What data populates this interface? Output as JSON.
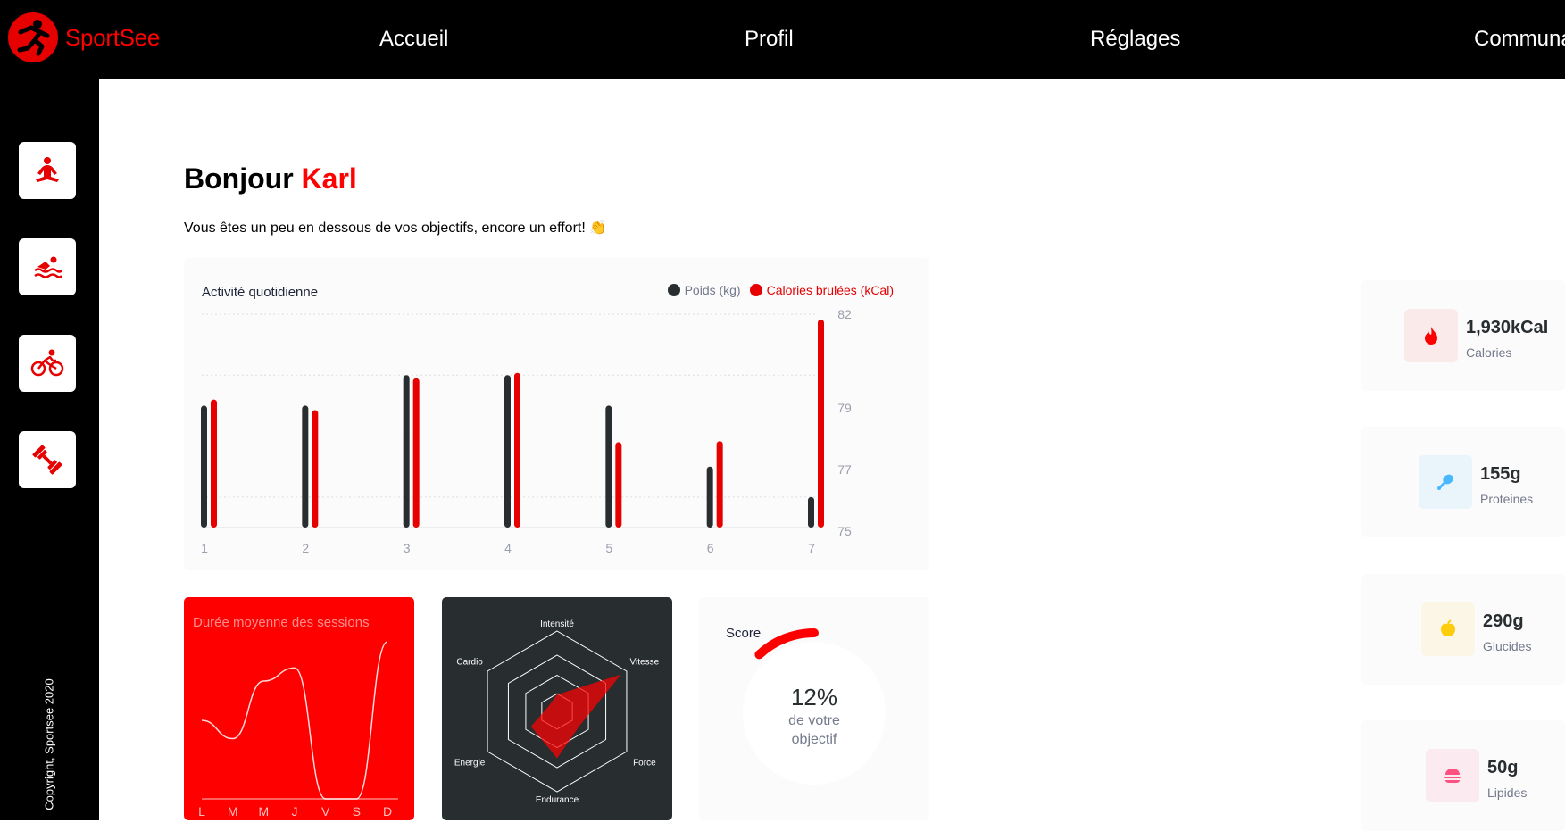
{
  "brand": {
    "name": "SportSee"
  },
  "nav": [
    {
      "label": "Accueil"
    },
    {
      "label": "Profil"
    },
    {
      "label": "Réglages"
    },
    {
      "label": "Communauté"
    }
  ],
  "sidebar": {
    "items": [
      {
        "icon": "meditation-icon"
      },
      {
        "icon": "swimming-icon"
      },
      {
        "icon": "cycling-icon"
      },
      {
        "icon": "dumbbell-icon"
      }
    ],
    "copyright": "Copyright, Sportsee 2020"
  },
  "greeting": {
    "prefix": "Bonjour ",
    "name": "Karl"
  },
  "subtitle": "Vous êtes un peu en dessous de vos objectifs, encore un effort! 👏",
  "colors": {
    "accent": "#ff0101",
    "dark": "#282d30"
  },
  "activity_chart": {
    "title": "Activité quotidienne",
    "legend": {
      "weight": "Poids (kg)",
      "calories": "Calories brulées (kCal)"
    },
    "chart_data": {
      "type": "bar",
      "categories": [
        "1",
        "2",
        "3",
        "4",
        "5",
        "6",
        "7"
      ],
      "series": [
        {
          "name": "Poids (kg)",
          "values": [
            79,
            79,
            80,
            80,
            79,
            77,
            76
          ]
        },
        {
          "name": "Calories brulées (kCal)",
          "values": [
            240,
            220,
            280,
            290,
            160,
            162,
            390
          ]
        }
      ],
      "y_ticks": [
        "82",
        "79",
        "77",
        "75"
      ],
      "ylim": [
        75,
        82
      ],
      "grid": true,
      "legend_position": "top-right"
    }
  },
  "duration_chart": {
    "title": "Durée moyenne des sessions",
    "chart_data": {
      "type": "line",
      "categories": [
        "L",
        "M",
        "M",
        "J",
        "V",
        "S",
        "D"
      ],
      "values": [
        30,
        23,
        45,
        50,
        0,
        0,
        60
      ]
    }
  },
  "radar_chart": {
    "chart_data": {
      "type": "radar",
      "categories": [
        "Intensité",
        "Vitesse",
        "Force",
        "Endurance",
        "Energie",
        "Cardio"
      ],
      "values": [
        50,
        220,
        80,
        140,
        90,
        30
      ],
      "max": 240
    }
  },
  "score": {
    "title": "Score",
    "value": "12%",
    "line1": "de votre",
    "line2": "objectif",
    "fraction": 0.12
  },
  "kpis": [
    {
      "value": "1,930kCal",
      "label": "Calories",
      "icon": "fire-icon",
      "bg": "#fbeaea",
      "color": "#ff0000"
    },
    {
      "value": "155g",
      "label": "Proteines",
      "icon": "chicken-leg-icon",
      "bg": "#e9f4fb",
      "color": "#4ab8ff"
    },
    {
      "value": "290g",
      "label": "Glucides",
      "icon": "apple-icon",
      "bg": "#fbf6e5",
      "color": "#fdcc0c"
    },
    {
      "value": "50g",
      "label": "Lipides",
      "icon": "burger-icon",
      "bg": "#fbeaef",
      "color": "#fd5181"
    }
  ]
}
